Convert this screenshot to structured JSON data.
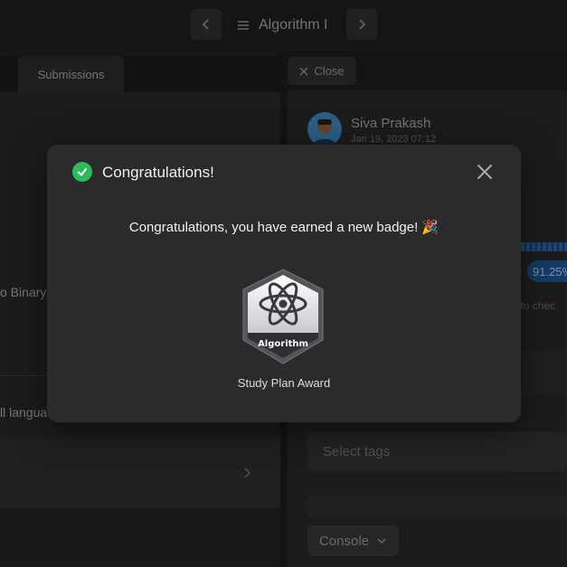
{
  "nav": {
    "title": "Algorithm I",
    "prev_icon": "chevron-left-icon",
    "next_icon": "chevron-right-icon",
    "list_icon": "list-icon"
  },
  "left_panel": {
    "tab_label": "Submissions",
    "row_text_1": "o Binary",
    "row_text_2": "ll langua"
  },
  "right_panel": {
    "close_label": "Close",
    "author": "Siva Prakash",
    "date": "Jan 19, 2023 07:12",
    "percentile": "91.25%",
    "hint": "k to chec",
    "tags_placeholder": "Select tags",
    "console_label": "Console"
  },
  "modal": {
    "title": "Congratulations!",
    "message": "Congratulations, you have earned a new badge! 🎉",
    "badge_text": "Algorithm",
    "badge_caption": "Study Plan Award"
  },
  "colors": {
    "success": "#2cbb5d",
    "modal_bg": "#2b2b2b",
    "accent_blue": "#1d4f8a"
  }
}
